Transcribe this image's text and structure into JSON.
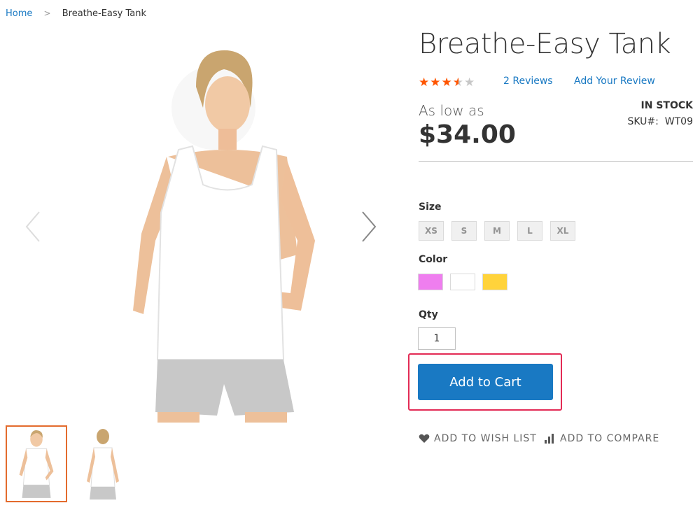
{
  "breadcrumb": {
    "home": "Home",
    "separator": ">",
    "current": "Breathe-Easy Tank"
  },
  "product": {
    "title": "Breathe-Easy Tank",
    "rating_stars_filled": 3.5,
    "rating_stars_total": 5,
    "reviews_link": "2  Reviews",
    "add_review_link": "Add Your Review",
    "price_prefix": "As low as",
    "price": "$34.00",
    "stock_status": "IN STOCK",
    "sku_label": "SKU#:",
    "sku_value": "WT09"
  },
  "options": {
    "size_label": "Size",
    "sizes": [
      "XS",
      "S",
      "M",
      "L",
      "XL"
    ],
    "color_label": "Color",
    "colors": [
      "#ef7eef",
      "#ffffff",
      "#ffd33b"
    ],
    "qty_label": "Qty",
    "qty_value": "1"
  },
  "actions": {
    "add_to_cart": "Add to Cart",
    "wishlist": "ADD TO WISH LIST",
    "compare": "ADD TO COMPARE"
  },
  "colors": {
    "accent": "#1979c3",
    "star": "#ff5501",
    "highlight": "#e32b55",
    "thumb_border": "#e36b2d"
  }
}
